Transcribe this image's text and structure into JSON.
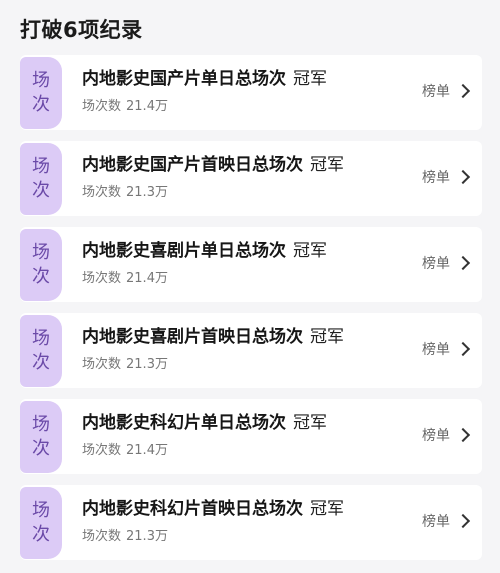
{
  "section": {
    "title": "打破6项纪录"
  },
  "records": [
    {
      "badge": [
        "场",
        "次"
      ],
      "title": "内地影史国产片单日总场次",
      "suffix": "冠军",
      "sub_label": "场次数",
      "sub_value": "21.4万",
      "link": "榜单"
    },
    {
      "badge": [
        "场",
        "次"
      ],
      "title": "内地影史国产片首映日总场次",
      "suffix": "冠军",
      "sub_label": "场次数",
      "sub_value": "21.3万",
      "link": "榜单"
    },
    {
      "badge": [
        "场",
        "次"
      ],
      "title": "内地影史喜剧片单日总场次",
      "suffix": "冠军",
      "sub_label": "场次数",
      "sub_value": "21.4万",
      "link": "榜单"
    },
    {
      "badge": [
        "场",
        "次"
      ],
      "title": "内地影史喜剧片首映日总场次",
      "suffix": "冠军",
      "sub_label": "场次数",
      "sub_value": "21.3万",
      "link": "榜单"
    },
    {
      "badge": [
        "场",
        "次"
      ],
      "title": "内地影史科幻片单日总场次",
      "suffix": "冠军",
      "sub_label": "场次数",
      "sub_value": "21.4万",
      "link": "榜单"
    },
    {
      "badge": [
        "场",
        "次"
      ],
      "title": "内地影史科幻片首映日总场次",
      "suffix": "冠军",
      "sub_label": "场次数",
      "sub_value": "21.3万",
      "link": "榜单"
    }
  ],
  "colors": {
    "badge_bg": "#dccbf6",
    "badge_text": "#6b4aa8",
    "card_bg": "#ffffff",
    "page_bg": "#f5f5f7"
  },
  "icons": {
    "link_arrow": "chevron-right-icon"
  }
}
